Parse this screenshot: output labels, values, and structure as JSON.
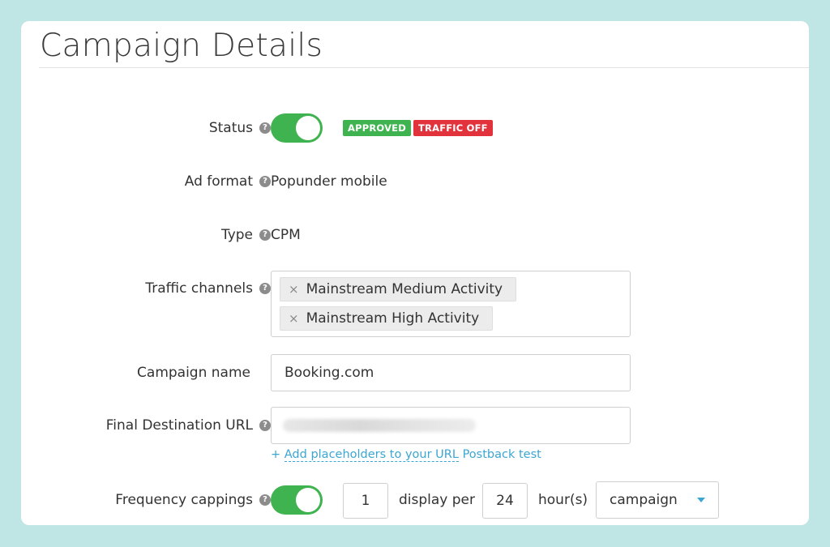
{
  "header": {
    "title": "Campaign Details"
  },
  "fields": {
    "status": {
      "label": "Status",
      "toggle_on": true,
      "badges": [
        {
          "text": "APPROVED",
          "color": "#3fb34f"
        },
        {
          "text": "TRAFFIC OFF",
          "color": "#e2333d"
        }
      ]
    },
    "ad_format": {
      "label": "Ad format",
      "value": "Popunder mobile"
    },
    "type": {
      "label": "Type",
      "value": "CPM"
    },
    "traffic_channels": {
      "label": "Traffic channels",
      "items": [
        {
          "remove": "×",
          "label": "Mainstream Medium Activity"
        },
        {
          "remove": "×",
          "label": "Mainstream High Activity"
        }
      ]
    },
    "campaign_name": {
      "label": "Campaign name",
      "value": "Booking.com"
    },
    "final_url": {
      "label": "Final Destination URL",
      "links": {
        "add_placeholders_prefix": "+ ",
        "add_placeholders": "Add placeholders to your URL",
        "postback": "Postback test"
      }
    },
    "frequency_cappings": {
      "label": "Frequency cappings",
      "toggle_on": true,
      "count": "1",
      "display_per_text": "display per",
      "hours": "24",
      "hours_text": "hour(s)",
      "scope": "campaign"
    }
  },
  "colors": {
    "accent_green": "#3fb34f",
    "link_blue": "#3ba6d2",
    "page_bg": "#bfe6e5"
  },
  "icons": {
    "help": "question-circle-icon",
    "remove": "times-icon",
    "caret": "caret-down-icon"
  }
}
